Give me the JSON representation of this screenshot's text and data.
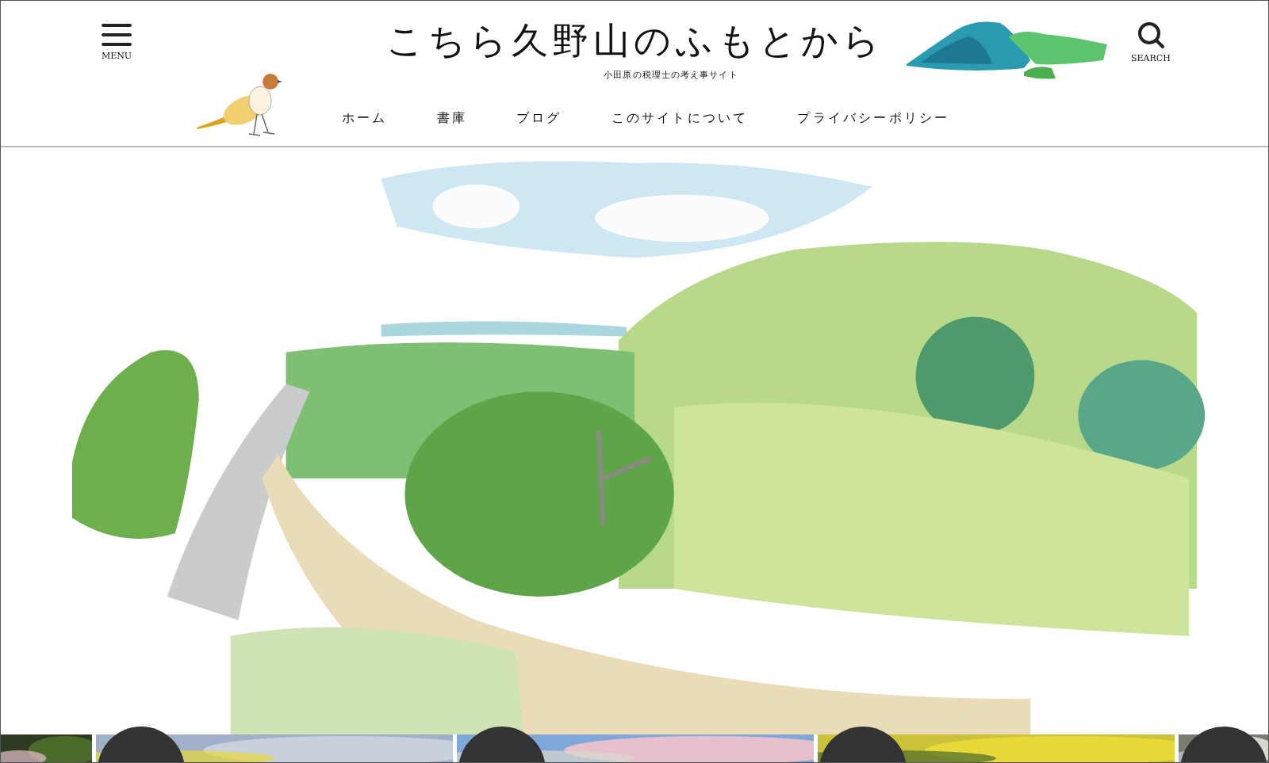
{
  "header": {
    "menu_label": "MENU",
    "site_title": "こちら久野山のふもとから",
    "tagline": "小田原の税理士の考え事サイト",
    "search_label": "SEARCH"
  },
  "nav": [
    {
      "label": "ホーム"
    },
    {
      "label": "書庫"
    },
    {
      "label": "ブログ"
    },
    {
      "label": "このサイトについて"
    },
    {
      "label": "プライバシーポリシー"
    }
  ],
  "hero": {
    "kind": "picture"
  },
  "cards": [
    {
      "kind": "picture",
      "badge": false
    },
    {
      "kind": "picture",
      "badge": true
    },
    {
      "kind": "picture",
      "badge": true
    },
    {
      "kind": "picture",
      "badge": true
    },
    {
      "kind": "picture",
      "badge": true
    }
  ]
}
